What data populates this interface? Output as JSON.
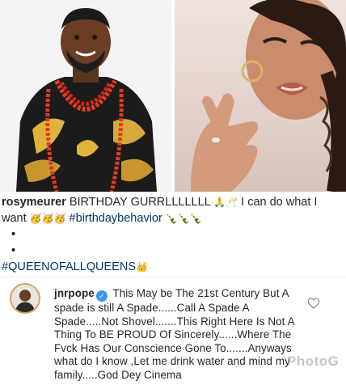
{
  "post": {
    "caption": {
      "username": "rosymeurer",
      "text_1": "BIRTHDAY GURRLLLLLLL",
      "emoji_1": "🙏🥂",
      "text_2": "I can do what I want",
      "emoji_2": "🥳🥳🥳",
      "hashtag_1": "#birthdaybehavior",
      "emoji_3": "🍾🍾🍾",
      "dot_1": "•",
      "dot_2": "•",
      "hashtag_2": "#QUEENOFALLQUEENS",
      "emoji_4": "👑"
    }
  },
  "comment": {
    "username": "jnrpope",
    "verified_mark": "✓",
    "text": "This May be The 21st Century But A spade is still A Spade......Call A Spade A Spade.....Not Shovel.......This Right Here Is Not A Thing To BE PROUD Of Sincerely......Where The Fvck Has Our Conscience Gone To.......Anyways what do I know ,Let me drink water and mind my family.....God Dey Cinema"
  },
  "icons": {
    "heart": "heart-outline-icon",
    "verified": "verified-badge-icon"
  },
  "colors": {
    "hashtag": "#00376b",
    "verified": "#3897f0",
    "text": "#262626"
  },
  "watermark": "PhotoG"
}
